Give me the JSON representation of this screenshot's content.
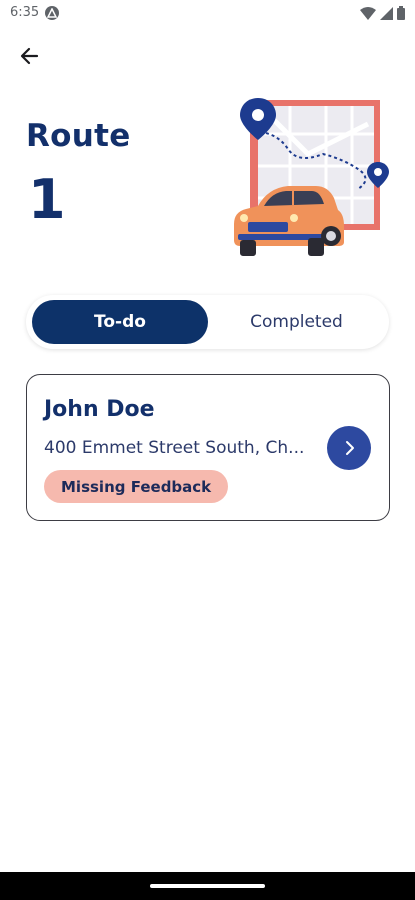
{
  "status_bar": {
    "time": "6:35"
  },
  "header": {
    "title": "Route",
    "route_number": "1"
  },
  "tabs": [
    {
      "label": "To-do",
      "active": true
    },
    {
      "label": "Completed",
      "active": false
    }
  ],
  "stops": [
    {
      "name": "John Doe",
      "address": "400 Emmet Street South, Ch...",
      "status": "Missing Feedback"
    }
  ],
  "colors": {
    "primary": "#13306b",
    "active_tab": "#0d3269",
    "arrow_button": "#2d49a0",
    "badge": "#f6b9ae",
    "map_frame": "#e8736a",
    "car": "#f0925a"
  },
  "icons": {
    "back": "arrow-left-icon",
    "next": "chevron-right-icon",
    "wifi": "wifi-icon",
    "signal": "cell-signal-icon",
    "battery": "battery-icon"
  }
}
